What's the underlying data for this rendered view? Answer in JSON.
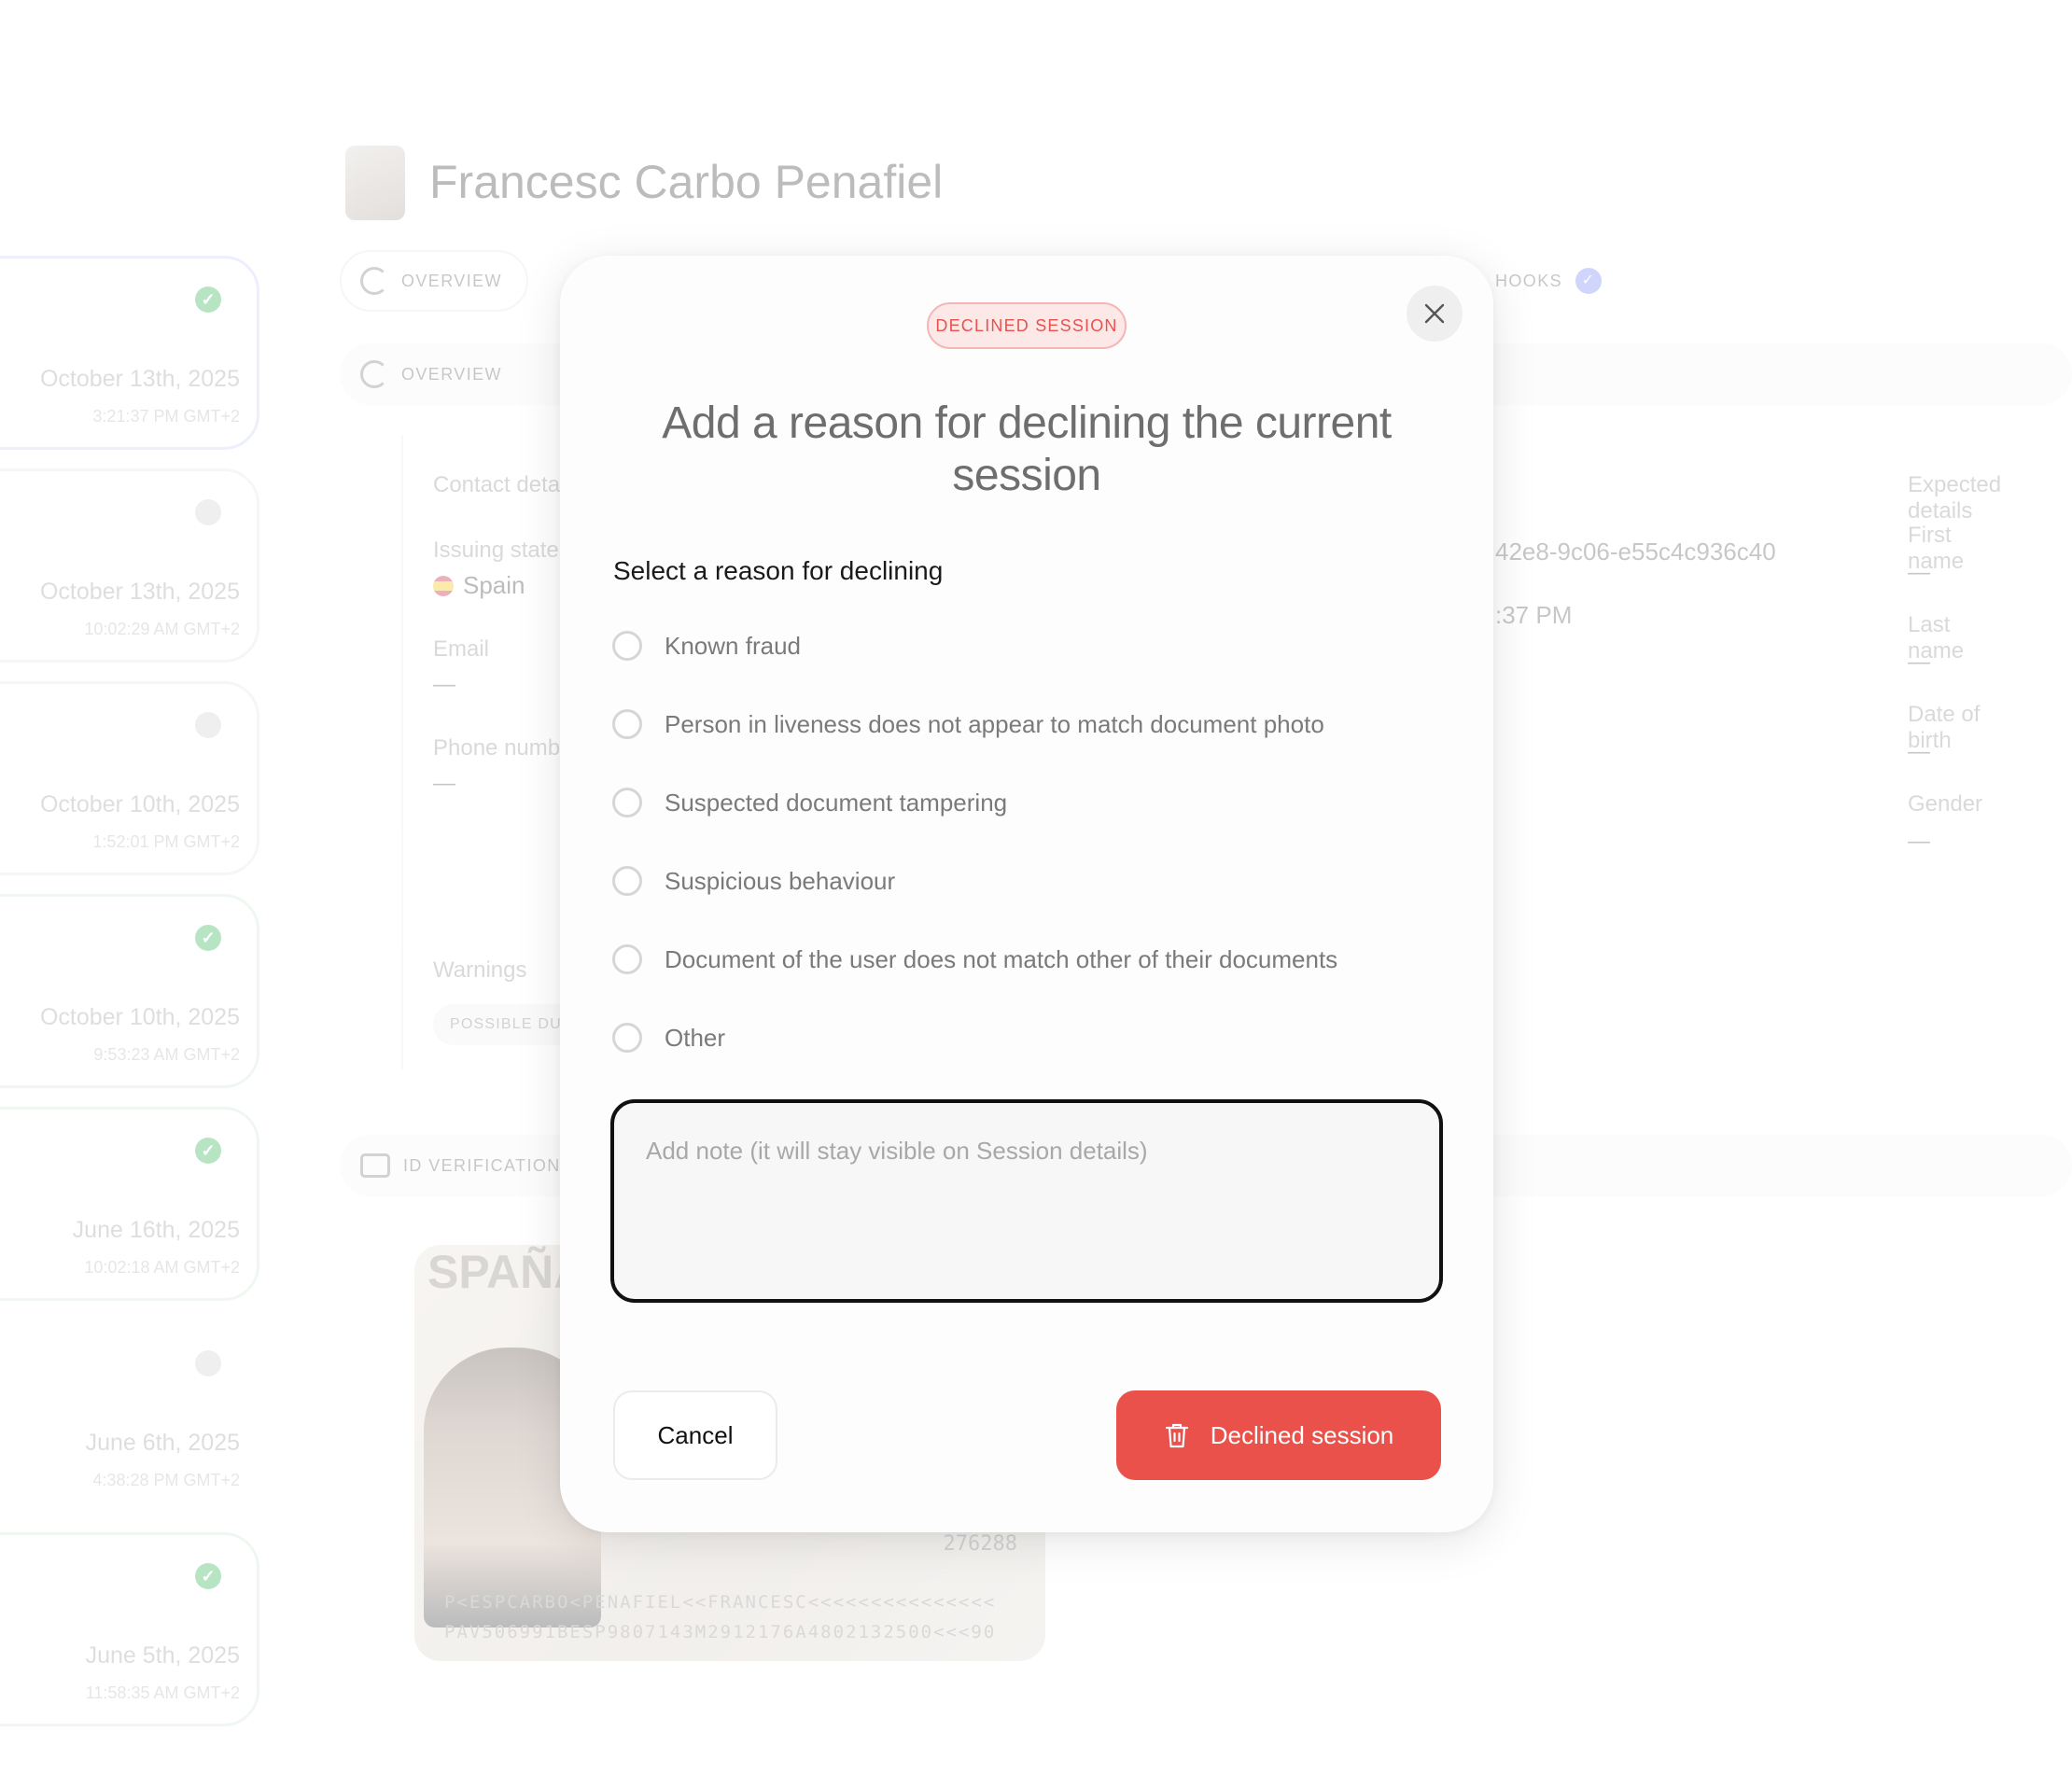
{
  "background": {
    "user_name": "Francesc Carbo Penafiel",
    "tabs": {
      "overview": "OVERVIEW",
      "webhooks": "HOOKS",
      "section_overview": "OVERVIEW",
      "id_verification": "ID VERIFICATION"
    },
    "sessions": [
      {
        "date": "October 13th, 2025",
        "time": "3:21:37 PM GMT+2"
      },
      {
        "date": "October 13th, 2025",
        "time": "10:02:29 AM GMT+2"
      },
      {
        "date": "October 10th, 2025",
        "time": "1:52:01 PM GMT+2"
      },
      {
        "date": "October 10th, 2025",
        "time": "9:53:23 AM GMT+2"
      },
      {
        "date": "June 16th, 2025",
        "time": "10:02:18 AM GMT+2"
      },
      {
        "date": "June 6th, 2025",
        "time": "4:38:28 PM GMT+2"
      },
      {
        "date": "June 5th, 2025",
        "time": "11:58:35 AM GMT+2"
      }
    ],
    "contact_details_label": "Contact deta",
    "issuing_state_label": "Issuing state",
    "issuing_state_value": "Spain",
    "email_label": "Email",
    "email_value": "—",
    "phone_label": "Phone numb",
    "phone_value": "—",
    "session_id_fragment": "42e8-9c06-e55c4c936c40",
    "time_fragment": ":37 PM",
    "warnings_label": "Warnings",
    "warning_chip": "POSSIBLE DU",
    "expected_details_label": "Expected details",
    "first_name_label": "First name",
    "first_name_value": "—",
    "last_name_label": "Last name",
    "last_name_value": "—",
    "dob_label": "Date of birth",
    "dob_value": "—",
    "gender_label": "Gender",
    "gender_value": "—",
    "id_card": {
      "country": "SPAÑA",
      "number": "276288",
      "mrz_line1": "P<ESPCARBO<PENAFIEL<<FRANCESC<<<<<<<<<<<<<<<",
      "mrz_line2": "PAV506991BESP9807143M2912176A4802132500<<<90"
    }
  },
  "modal": {
    "badge": "DECLINED SESSION",
    "title": "Add a reason for declining the current session",
    "section_label": "Select a reason for declining",
    "reasons": [
      "Known fraud",
      "Person in liveness does not appear to match document photo",
      "Suspected document tampering",
      "Suspicious behaviour",
      "Document of the user does not match other of their documents",
      "Other"
    ],
    "note_placeholder": "Add note (it will stay visible on Session details)",
    "note_value": "",
    "cancel_label": "Cancel",
    "decline_label": "Declined session",
    "decline_icon": "trash-icon",
    "close_icon": "close-icon",
    "colors": {
      "danger": "#ea514b",
      "badge_bg": "#fde8e8"
    }
  }
}
